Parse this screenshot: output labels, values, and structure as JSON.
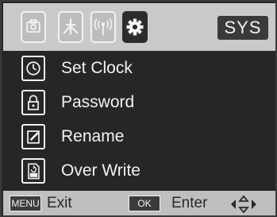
{
  "tabs": [
    {
      "icon": "camera-icon",
      "active": false
    },
    {
      "icon": "network-icon",
      "active": false
    },
    {
      "icon": "signal-icon",
      "active": false
    },
    {
      "icon": "gear-icon",
      "active": true
    }
  ],
  "header": {
    "sys_label": "SYS"
  },
  "menu": {
    "items": [
      {
        "label": "Set Clock",
        "icon": "clock-icon"
      },
      {
        "label": "Password",
        "icon": "lock-icon"
      },
      {
        "label": "Rename",
        "icon": "edit-icon"
      },
      {
        "label": "Over Write",
        "icon": "sd-card-icon"
      }
    ]
  },
  "footer": {
    "menu_key": "MENU",
    "menu_action": "Exit",
    "ok_key": "OK",
    "ok_action": "Enter",
    "nav_icon": "dpad-icon"
  }
}
